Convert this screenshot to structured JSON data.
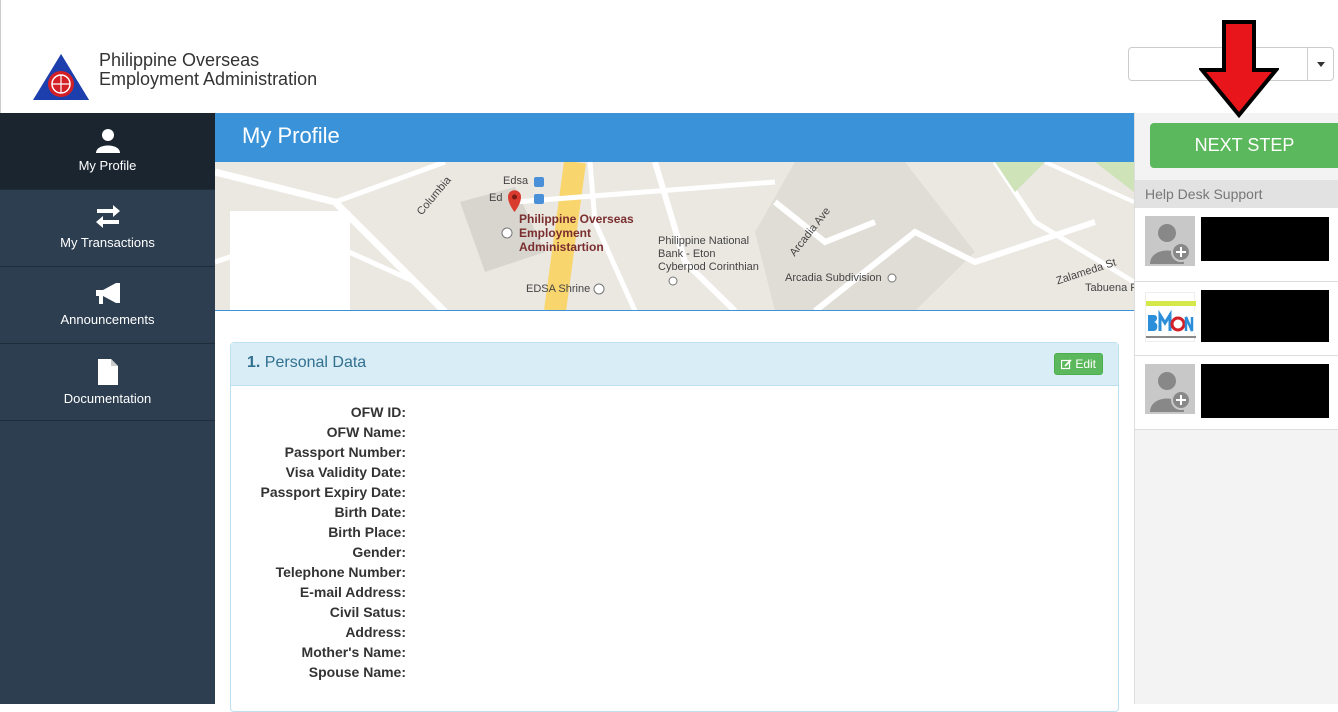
{
  "header": {
    "org_name_line1": "Philippine Overseas",
    "org_name_line2": "Employment Administration",
    "select_value": ""
  },
  "sidebar": {
    "items": [
      {
        "label": "My Profile",
        "icon": "user-icon",
        "active": true
      },
      {
        "label": "My Transactions",
        "icon": "transfer-arrows-icon",
        "active": false
      },
      {
        "label": "Announcements",
        "icon": "megaphone-icon",
        "active": false
      },
      {
        "label": "Documentation",
        "icon": "document-icon",
        "active": false
      }
    ]
  },
  "main": {
    "title": "My Profile",
    "map": {
      "labels": [
        "Columbia",
        "Edsa",
        "Ed",
        "Philippine Overseas",
        "Employment",
        "Administartion",
        "Philippine National",
        "Bank - Eton",
        "Cyberpod Corinthian",
        "Arcadia Ave",
        "Arcadia Subdivision",
        "Zalameda St",
        "Tabuena P",
        "EDSA Shrine"
      ]
    },
    "panel": {
      "number": "1.",
      "title": "Personal Data",
      "edit_label": "Edit",
      "fields": [
        "OFW ID:",
        "OFW Name:",
        "Passport Number:",
        "Visa Validity Date:",
        "Passport Expiry Date:",
        "Birth Date:",
        "Birth Place:",
        "Gender:",
        "Telephone Number:",
        "E-mail Address:",
        "Civil Satus:",
        "Address:",
        "Mother's Name:",
        "Spouse Name:"
      ]
    }
  },
  "right": {
    "next_step_label": "NEXT STEP",
    "help_title": "Help Desk Support"
  },
  "colors": {
    "header_blue": "#3a93d8",
    "sidebar": "#2c3e50",
    "green": "#5cb85c",
    "arrow_red": "#e8161b"
  }
}
